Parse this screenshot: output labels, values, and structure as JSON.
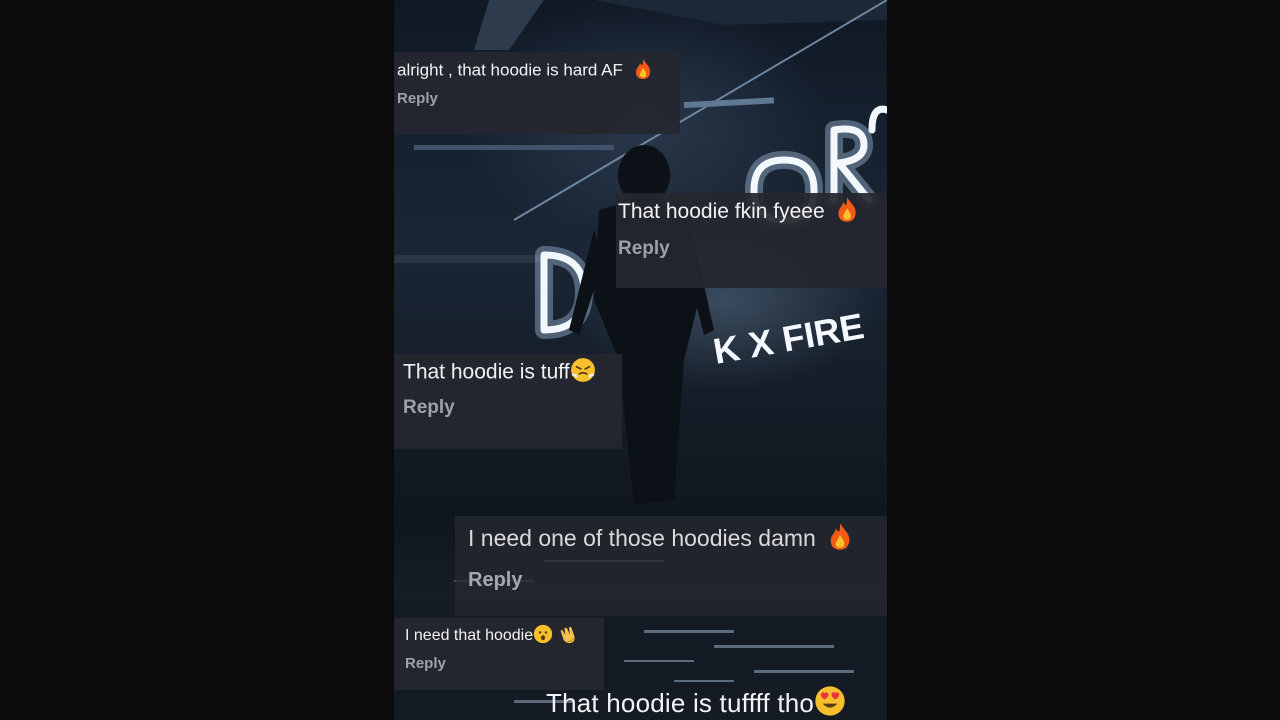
{
  "comments": [
    {
      "text": "alright , that hoodie is hard AF",
      "emoji": "fire-icon",
      "reply": "Reply"
    },
    {
      "text": "That hoodie fkin fyeee",
      "emoji": "fire-icon",
      "reply": "Reply"
    },
    {
      "text": "That hoodie is tuff",
      "emoji": "steaming-face-icon",
      "reply": "Reply"
    },
    {
      "text": "I need one of those hoodies damn",
      "emoji": "fire-icon",
      "reply": "Reply"
    },
    {
      "text": "I need that hoodie",
      "emoji": "surprised-face-icon, clapping-hands-icon",
      "reply": "Reply"
    },
    {
      "text": "That hoodie is tuffff tho",
      "emoji": "heart-eyes-face-icon"
    }
  ],
  "background": {
    "neon_sign_text": "K X FIRE",
    "colors": {
      "neon": "#f3f8ff",
      "bubble": "#25272e",
      "reply": "#9ea1a8",
      "page": "#0b0b0c"
    }
  }
}
